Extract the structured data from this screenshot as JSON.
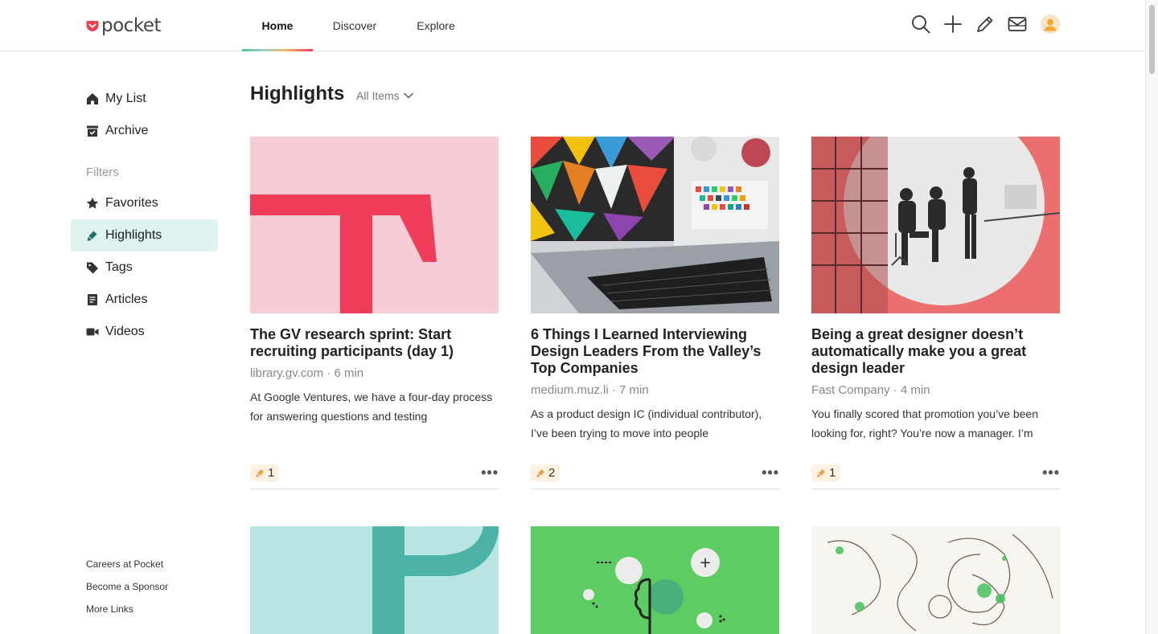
{
  "app": {
    "logo_text": "pocket"
  },
  "nav": {
    "tabs": [
      {
        "label": "Home"
      },
      {
        "label": "Discover"
      },
      {
        "label": "Explore"
      }
    ]
  },
  "sidebar": {
    "items": [
      {
        "label": "My List",
        "icon": "home-icon"
      },
      {
        "label": "Archive",
        "icon": "archive-icon"
      }
    ],
    "filters_label": "Filters",
    "filters": [
      {
        "label": "Favorites",
        "icon": "star-icon"
      },
      {
        "label": "Highlights",
        "icon": "highlighter-icon",
        "active": true
      },
      {
        "label": "Tags",
        "icon": "tag-icon"
      },
      {
        "label": "Articles",
        "icon": "article-icon"
      },
      {
        "label": "Videos",
        "icon": "video-icon"
      }
    ],
    "footer_links": [
      "Careers at Pocket",
      "Become a Sponsor",
      "More Links"
    ]
  },
  "main": {
    "title": "Highlights",
    "filter_dropdown": "All Items",
    "cards": [
      {
        "title": "The GV research sprint: Start recruiting participants (day 1)",
        "meta": "library.gv.com · 6 min",
        "excerpt": "At Google Ventures, we have a four-day process for answering questions and testing",
        "highlights": "1"
      },
      {
        "title": "6 Things I Learned Interviewing Design Leaders From the Valley’s Top Companies",
        "meta": "medium.muz.li · 7 min",
        "excerpt": "As a product design IC (individual contributor), I’ve been trying to move into people",
        "highlights": "2"
      },
      {
        "title": "Being a great designer doesn’t automatically make you a great design leader",
        "meta": "Fast Company · 4 min",
        "excerpt": "You finally scored that promotion you’ve been looking for, right? You’re now a manager. I’m",
        "highlights": "1"
      }
    ]
  },
  "colors": {
    "accent": "#ef4056",
    "active_bg": "#dff3f1",
    "highlight_badge": "#fdf2e1"
  }
}
